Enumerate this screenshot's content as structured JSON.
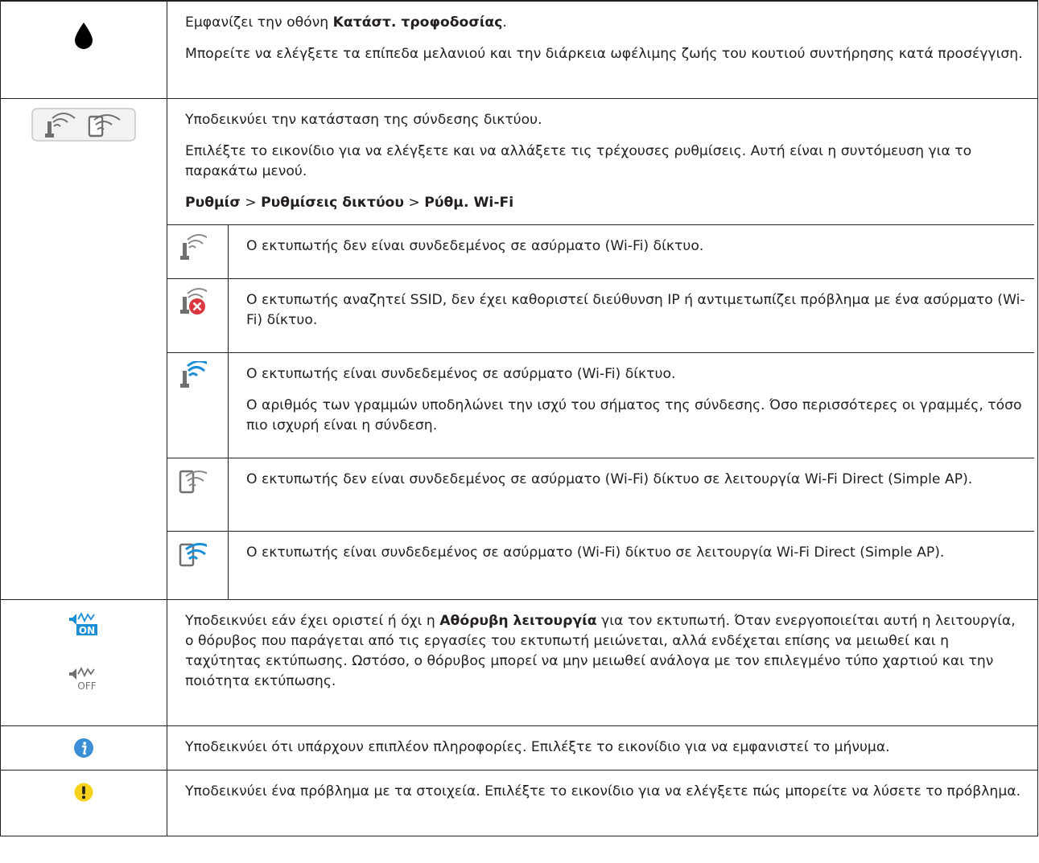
{
  "rows": {
    "ink": {
      "icon": "ink-drop-icon",
      "p1_pre": "Εμφανίζει την οθόνη ",
      "p1_bold": "Κατάστ. τροφοδοσίας",
      "p1_post": ".",
      "p2": "Μπορείτε να ελέγξετε τα επίπεδα μελανιού και την διάρκεια ωφέλιμης ζωής του κουτιού συντήρησης κατά προσέγγιση."
    },
    "network": {
      "icon": "network-status-button-icon",
      "p1": "Υποδεικνύει την κατάσταση της σύνδεσης δικτύου.",
      "p2": "Επιλέξτε το εικονίδιο για να ελέγξετε και να αλλάξετε τις τρέχουσες ρυθμίσεις. Αυτή είναι η συντόμευση για το παρακάτω μενού.",
      "menu_path": {
        "a": "Ρυθμίσ",
        "sep1": " > ",
        "b": "Ρυθμίσεις δικτύου",
        "sep2": " > ",
        "c": "Ρύθμ. Wi-Fi"
      },
      "sub": [
        {
          "icon": "wifi-disconnected-icon",
          "text": "Ο εκτυπωτής δεν είναι συνδεδεμένος σε ασύρματο (Wi-Fi) δίκτυο."
        },
        {
          "icon": "wifi-error-icon",
          "text": "Ο εκτυπωτής αναζητεί SSID, δεν έχει καθοριστεί διεύθυνση IP ή αντιμετωπίζει πρόβλημα με ένα ασύρματο (Wi-Fi) δίκτυο."
        },
        {
          "icon": "wifi-connected-icon",
          "text": "Ο εκτυπωτής είναι συνδεδεμένος σε ασύρματο (Wi-Fi) δίκτυο.",
          "text2": "Ο αριθμός των γραμμών υποδηλώνει την ισχύ του σήματος της σύνδεσης. Όσο περισσότερες οι γραμμές, τόσο πιο ισχυρή είναι η σύνδεση."
        },
        {
          "icon": "wifi-direct-disconnected-icon",
          "text": "Ο εκτυπωτής δεν είναι συνδεδεμένος σε ασύρματο (Wi-Fi) δίκτυο σε λειτουργία Wi-Fi Direct (Simple AP)."
        },
        {
          "icon": "wifi-direct-connected-icon",
          "text": "Ο εκτυπωτής είναι συνδεδεμένος σε ασύρματο (Wi-Fi) δίκτυο σε λειτουργία Wi-Fi Direct (Simple AP)."
        }
      ]
    },
    "quiet": {
      "icon_on": "quiet-mode-on-icon",
      "icon_off": "quiet-mode-off-icon",
      "on_label": "ON",
      "off_label": "OFF",
      "p_pre": "Υποδεικνύει εάν έχει οριστεί ή όχι η ",
      "p_bold": "Αθόρυβη λειτουργία",
      "p_post": " για τον εκτυπωτή. Όταν ενεργοποιείται αυτή η λειτουργία, ο θόρυβος που παράγεται από τις εργασίες του εκτυπωτή μειώνεται, αλλά ενδέχεται επίσης να μειωθεί και η ταχύτητας εκτύπωσης. Ωστόσο, ο θόρυβος μπορεί να μην μειωθεί ανάλογα με τον επιλεγμένο τύπο χαρτιού και την ποιότητα εκτύπωσης."
    },
    "info": {
      "icon": "info-icon",
      "p": "Υποδεικνύει ότι υπάρχουν επιπλέον πληροφορίες. Επιλέξτε το εικονίδιο για να εμφανιστεί το μήνυμα."
    },
    "warning": {
      "icon": "warning-icon",
      "p": "Υποδεικνύει ένα πρόβλημα με τα στοιχεία. Επιλέξτε το εικονίδιο για να ελέγξετε πώς μπορείτε να λύσετε το πρόβλημα."
    }
  },
  "colors": {
    "text": "#231f20",
    "icon_grey": "#707070",
    "wifi_blue": "#1a8fd6",
    "error_red": "#d9373d",
    "info_blue": "#3b8fd6",
    "warning_yellow": "#f7d21c"
  }
}
